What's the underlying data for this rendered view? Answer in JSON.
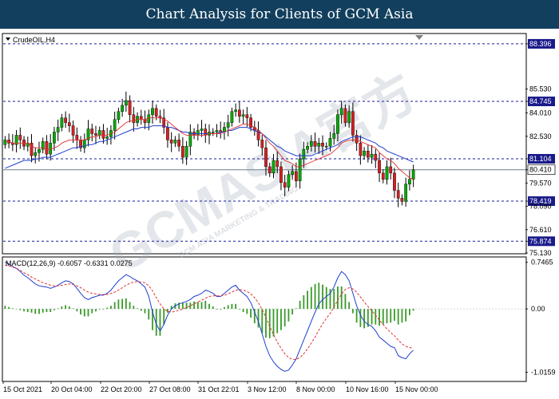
{
  "banner": {
    "title": "Chart Analysis for Clients of GCM Asia"
  },
  "watermark": {
    "text": "GCMASIA官方",
    "subtext": "GCM ASIA MARKETING & TRADING"
  },
  "colors": {
    "banner": "#123f5e",
    "bull": "#00aa00",
    "bear": "#d62020",
    "wick": "#000000",
    "ma_fast": "#e03030",
    "ma_slow": "#1f3fd0",
    "level_line": "#1a1aa0",
    "price_line": "#6f7f8f",
    "macd_line": "#1f3fd0",
    "signal_line": "#e03030",
    "histogram": "#3a9a2a"
  },
  "chart_data": [
    {
      "type": "candlestick",
      "title": "CrudeOIL,H4",
      "ylim": [
        75.13,
        89.0
      ],
      "y_ticks": [
        "88.396",
        "85.530",
        "84.745",
        "84.010",
        "82.530",
        "81.104",
        "80.410",
        "79.570",
        "78.419",
        "78.090",
        "76.610",
        "75.874",
        "75.130"
      ],
      "y_tick_values": [
        88.396,
        85.53,
        84.745,
        84.01,
        82.53,
        81.104,
        80.41,
        79.57,
        78.419,
        78.09,
        76.61,
        75.874,
        75.13
      ],
      "highlighted_labels": [
        {
          "label": "88.396",
          "value": 88.396,
          "style": "level"
        },
        {
          "label": "84.745",
          "value": 84.745,
          "style": "level"
        },
        {
          "label": "81.104",
          "value": 81.104,
          "style": "level"
        },
        {
          "label": "80.410",
          "value": 80.41,
          "style": "price"
        },
        {
          "label": "78.419",
          "value": 78.419,
          "style": "level"
        },
        {
          "label": "75.874",
          "value": 75.874,
          "style": "level"
        }
      ],
      "levels": [
        88.396,
        84.745,
        81.104,
        78.419,
        75.874
      ],
      "current_price": 80.41,
      "x_tick_labels": [
        "15 Oct 2021",
        "20 Oct 04:00",
        "22 Oct 20:00",
        "27 Oct 08:00",
        "31 Oct 22:01",
        "3 Nov 12:00",
        "8 Nov 00:00",
        "10 Nov 16:00",
        "15 Nov 00:00"
      ],
      "series": [
        {
          "name": "Close",
          "values": [
            82.3,
            82.1,
            82.0,
            82.6,
            82.3,
            81.9,
            82.1,
            81.3,
            81.5,
            81.7,
            82.2,
            81.4,
            82.1,
            82.8,
            83.1,
            83.7,
            83.4,
            83.2,
            82.6,
            82.3,
            81.8,
            82.3,
            83.0,
            82.7,
            82.6,
            82.9,
            82.4,
            82.5,
            82.9,
            83.6,
            84.1,
            84.5,
            84.8,
            83.9,
            83.4,
            83.8,
            83.6,
            83.4,
            83.9,
            84.3,
            83.8,
            83.7,
            83.1,
            82.3,
            82.1,
            82.3,
            81.9,
            81.2,
            81.9,
            82.8,
            82.6,
            82.9,
            83.0,
            82.6,
            82.8,
            82.8,
            82.9,
            82.8,
            83.1,
            83.4,
            84.1,
            84.2,
            83.8,
            83.9,
            83.7,
            83.1,
            82.9,
            82.3,
            81.8,
            80.6,
            80.2,
            81.0,
            80.6,
            79.6,
            79.3,
            80.1,
            80.3,
            79.7,
            81.1,
            81.7,
            81.9,
            82.2,
            81.9,
            82.1,
            81.9,
            81.9,
            82.4,
            82.7,
            83.9,
            84.3,
            83.4,
            84.1,
            82.6,
            82.1,
            81.3,
            81.6,
            81.2,
            81.4,
            81.0,
            80.2,
            79.8,
            80.6,
            80.2,
            79.1,
            78.6,
            78.4,
            79.5,
            79.8,
            80.4
          ]
        },
        {
          "name": "Open",
          "values": [
            82.0,
            82.3,
            82.1,
            82.0,
            82.6,
            82.3,
            81.9,
            82.1,
            81.3,
            81.5,
            81.7,
            82.2,
            81.4,
            82.1,
            82.8,
            83.1,
            83.7,
            83.4,
            83.2,
            82.6,
            82.3,
            81.8,
            82.3,
            83.0,
            82.7,
            82.6,
            82.9,
            82.4,
            82.5,
            82.9,
            83.6,
            84.1,
            84.5,
            84.8,
            83.9,
            83.4,
            83.8,
            83.6,
            83.4,
            83.9,
            84.3,
            83.8,
            83.7,
            83.1,
            82.3,
            82.1,
            82.3,
            81.9,
            81.2,
            81.9,
            82.8,
            82.6,
            82.9,
            83.0,
            82.6,
            82.8,
            82.8,
            82.9,
            82.8,
            83.1,
            83.4,
            84.1,
            84.2,
            83.8,
            83.9,
            83.7,
            83.1,
            82.9,
            82.3,
            81.8,
            80.6,
            80.2,
            81.0,
            80.6,
            79.6,
            79.3,
            80.1,
            80.3,
            79.7,
            81.1,
            81.7,
            81.9,
            82.2,
            81.9,
            82.1,
            81.9,
            81.9,
            82.4,
            82.7,
            83.9,
            84.3,
            83.4,
            84.1,
            82.6,
            82.1,
            81.3,
            81.6,
            81.2,
            81.4,
            81.0,
            80.2,
            79.8,
            80.6,
            80.2,
            79.1,
            78.6,
            78.4,
            79.5,
            79.8
          ]
        },
        {
          "name": "MA fast",
          "values": [
            82.2,
            82.2,
            82.1,
            82.1,
            82.1,
            82.1,
            82.1,
            81.9,
            81.8,
            81.8,
            81.8,
            81.7,
            81.7,
            81.8,
            81.9,
            82.1,
            82.2,
            82.3,
            82.3,
            82.3,
            82.3,
            82.3,
            82.4,
            82.5,
            82.5,
            82.6,
            82.6,
            82.6,
            82.7,
            82.8,
            83.0,
            83.2,
            83.4,
            83.5,
            83.5,
            83.6,
            83.6,
            83.6,
            83.7,
            83.7,
            83.7,
            83.7,
            83.6,
            83.5,
            83.3,
            83.1,
            82.9,
            82.7,
            82.6,
            82.6,
            82.6,
            82.6,
            82.6,
            82.6,
            82.7,
            82.7,
            82.7,
            82.7,
            82.8,
            82.9,
            83.0,
            83.1,
            83.2,
            83.3,
            83.3,
            83.2,
            83.1,
            82.9,
            82.7,
            82.4,
            82.1,
            81.9,
            81.6,
            81.3,
            81.0,
            80.9,
            80.8,
            80.6,
            80.6,
            80.7,
            80.8,
            80.9,
            81.0,
            81.1,
            81.2,
            81.3,
            81.4,
            81.6,
            81.8,
            82.1,
            82.2,
            82.3,
            82.3,
            82.3,
            82.2,
            82.1,
            82.0,
            81.9,
            81.8,
            81.5,
            81.3,
            81.1,
            81.0,
            80.8,
            80.5,
            80.3,
            80.1,
            79.9,
            79.8
          ]
        },
        {
          "name": "MA slow",
          "values": [
            80.5,
            80.6,
            80.7,
            80.8,
            80.9,
            81.0,
            81.0,
            81.0,
            81.1,
            81.1,
            81.2,
            81.2,
            81.2,
            81.3,
            81.4,
            81.5,
            81.6,
            81.7,
            81.8,
            81.8,
            81.9,
            81.9,
            82.0,
            82.0,
            82.1,
            82.2,
            82.2,
            82.3,
            82.4,
            82.5,
            82.6,
            82.7,
            82.8,
            82.9,
            83.0,
            83.0,
            83.1,
            83.1,
            83.1,
            83.2,
            83.2,
            83.2,
            83.2,
            83.1,
            83.1,
            83.0,
            82.9,
            82.8,
            82.8,
            82.7,
            82.7,
            82.7,
            82.7,
            82.7,
            82.7,
            82.7,
            82.7,
            82.8,
            82.8,
            82.9,
            82.9,
            83.0,
            83.1,
            83.1,
            83.1,
            83.0,
            82.9,
            82.8,
            82.7,
            82.5,
            82.3,
            82.1,
            81.9,
            81.8,
            81.6,
            81.5,
            81.4,
            81.3,
            81.3,
            81.3,
            81.3,
            81.3,
            81.4,
            81.5,
            81.6,
            81.7,
            81.8,
            81.9,
            82.0,
            82.2,
            82.3,
            82.4,
            82.5,
            82.5,
            82.5,
            82.4,
            82.3,
            82.2,
            82.1,
            81.9,
            81.8,
            81.6,
            81.5,
            81.4,
            81.3,
            81.2,
            81.1,
            81.0,
            80.9
          ]
        }
      ]
    },
    {
      "type": "line",
      "title": "MACD(12,26,9) -0.6057 -0.6331 0.0275",
      "ylim": [
        -1.15,
        0.82
      ],
      "y_ticks": [
        "0.7465",
        "0.00",
        "-1.0159"
      ],
      "y_tick_values": [
        0.7465,
        0.0,
        -1.0159
      ],
      "series": [
        {
          "name": "MACD",
          "values": [
            0.75,
            0.72,
            0.68,
            0.65,
            0.6,
            0.54,
            0.5,
            0.45,
            0.4,
            0.37,
            0.36,
            0.35,
            0.33,
            0.35,
            0.38,
            0.42,
            0.45,
            0.44,
            0.4,
            0.33,
            0.25,
            0.18,
            0.15,
            0.18,
            0.2,
            0.22,
            0.22,
            0.25,
            0.3,
            0.38,
            0.45,
            0.5,
            0.55,
            0.52,
            0.48,
            0.45,
            0.4,
            0.35,
            0.2,
            -0.05,
            -0.25,
            -0.35,
            -0.25,
            -0.1,
            0.0,
            0.05,
            0.08,
            0.1,
            0.12,
            0.15,
            0.2,
            0.22,
            0.25,
            0.3,
            0.28,
            0.25,
            0.2,
            0.2,
            0.25,
            0.3,
            0.35,
            0.38,
            0.3,
            0.25,
            0.2,
            0.1,
            -0.05,
            -0.2,
            -0.4,
            -0.6,
            -0.75,
            -0.85,
            -0.92,
            -0.97,
            -1.0,
            -0.98,
            -0.9,
            -0.8,
            -0.65,
            -0.5,
            -0.35,
            -0.2,
            -0.05,
            0.08,
            0.15,
            0.2,
            0.25,
            0.35,
            0.5,
            0.6,
            0.55,
            0.45,
            0.25,
            0.05,
            -0.1,
            -0.2,
            -0.25,
            -0.28,
            -0.35,
            -0.45,
            -0.5,
            -0.55,
            -0.6,
            -0.62,
            -0.75,
            -0.78,
            -0.8,
            -0.72,
            -0.66
          ]
        },
        {
          "name": "Signal",
          "values": [
            0.7,
            0.69,
            0.67,
            0.65,
            0.62,
            0.58,
            0.55,
            0.51,
            0.48,
            0.45,
            0.42,
            0.4,
            0.38,
            0.37,
            0.37,
            0.38,
            0.39,
            0.4,
            0.39,
            0.37,
            0.34,
            0.3,
            0.27,
            0.25,
            0.24,
            0.23,
            0.23,
            0.23,
            0.25,
            0.27,
            0.3,
            0.34,
            0.38,
            0.41,
            0.43,
            0.44,
            0.43,
            0.42,
            0.37,
            0.29,
            0.18,
            0.08,
            0.0,
            -0.04,
            -0.05,
            -0.04,
            -0.02,
            0.0,
            0.02,
            0.05,
            0.08,
            0.11,
            0.14,
            0.17,
            0.2,
            0.21,
            0.21,
            0.21,
            0.22,
            0.24,
            0.27,
            0.3,
            0.31,
            0.3,
            0.28,
            0.24,
            0.18,
            0.1,
            -0.01,
            -0.14,
            -0.28,
            -0.41,
            -0.53,
            -0.63,
            -0.72,
            -0.78,
            -0.81,
            -0.81,
            -0.78,
            -0.72,
            -0.64,
            -0.55,
            -0.45,
            -0.34,
            -0.24,
            -0.15,
            -0.07,
            0.03,
            0.14,
            0.24,
            0.31,
            0.34,
            0.32,
            0.27,
            0.19,
            0.11,
            0.04,
            -0.03,
            -0.1,
            -0.18,
            -0.25,
            -0.32,
            -0.38,
            -0.43,
            -0.5,
            -0.56,
            -0.6,
            -0.62,
            -0.63
          ]
        }
      ]
    }
  ]
}
